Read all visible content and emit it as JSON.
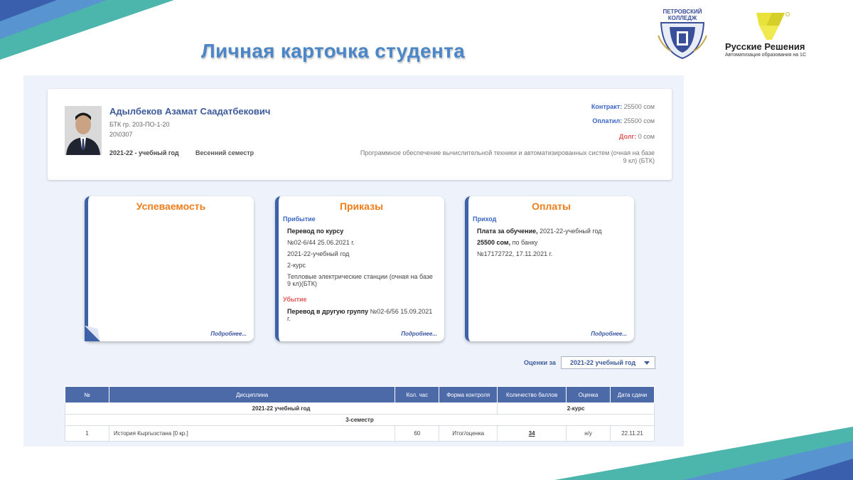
{
  "slide": {
    "title": "Личная карточка студента",
    "logo_pk_caption": "ПЕТРОВСКИЙ КОЛЛЕДЖ",
    "logo_rr_name": "Русские Решения",
    "logo_rr_sub": "Автоматизация образования на 1С",
    "colors": {
      "title": "#4a86c8",
      "accent_orange": "#ef7d1a",
      "accent_blue": "#3e62a8",
      "accent_red": "#e05a5a"
    }
  },
  "student": {
    "name": "Адылбеков Азамат Саадатбекович",
    "group": "БТК гр. 203-ПО-1-20",
    "id": "20\\0307",
    "year": "2021-22 - учебный год",
    "semester": "Весенний семестр",
    "contract_label": "Контракт:",
    "contract_value": " 25500 сом",
    "paid_label": "Оплатил:",
    "paid_value": " 25500 сом",
    "debt_label": "Долг:",
    "debt_value": " 0 сом",
    "specialty": "Программное обеспечение вычислительной техники и автоматизированных систем (очная на базе 9 кл) (БТК)"
  },
  "cards": {
    "performance": {
      "title": "Успеваемость",
      "more": "Подробнее..."
    },
    "orders": {
      "title": "Приказы",
      "arrival_label": "Прибытие",
      "arrival_order": "Перевод по курсу",
      "arrival_number": "№02-6/44 25.06.2021 г.",
      "arrival_year": "2021-22-учебный год",
      "arrival_course": "2-курс",
      "arrival_specialty": "Тепловые электрические станции (очная на базе 9 кл)(БТК)",
      "departure_label": "Убытие",
      "departure_order": "Перевод в другую группу",
      "departure_number": " №02-6/56 15.09.2021 г.",
      "more": "Подробнее..."
    },
    "payments": {
      "title": "Оплаты",
      "income_label": "Приход",
      "payment_name": "Плата за обучение,",
      "payment_year": " 2021-22-учебный год",
      "amount": "25500 сом,",
      "amount_method": " по банку",
      "receipt": "№17172722, 17.11.2021 г.",
      "more": "Подробнее..."
    }
  },
  "grades": {
    "label": "Оценки за",
    "selected_year": "2021-22 учебный год",
    "columns": [
      "№",
      "Дисциплина",
      "Кол. час",
      "Форма контроля",
      "Количество баллов",
      "Оценка",
      "Дата сдачи"
    ],
    "group_year": "2021-22 учебный год",
    "group_course": "2-курс",
    "group_semester": "3-семестр",
    "rows": [
      {
        "num": "1",
        "discipline": "История Кыргызстана [0 кр.]",
        "hours": "60",
        "control": "Итог/оценка",
        "points": "34",
        "grade": "н/у",
        "date": "22.11.21"
      }
    ]
  }
}
